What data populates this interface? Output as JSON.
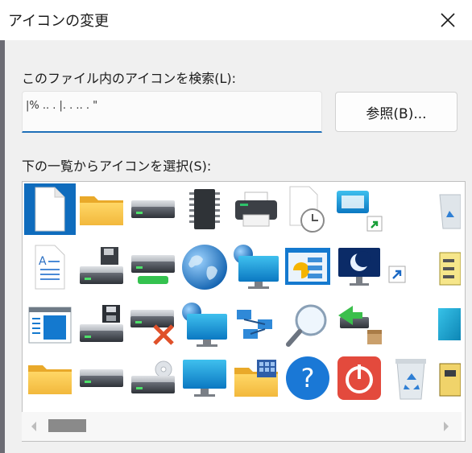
{
  "window": {
    "title": "アイコンの変更",
    "close_glyph": "✕"
  },
  "search": {
    "label": "このファイル内のアイコンを検索(L):",
    "value": "|%         ..  .  |.   .               ..  .  \"",
    "browse_label": "参照(B)..."
  },
  "icon_list": {
    "label": "下の一覧からアイコンを選択(S):",
    "selected_index": 0,
    "icons": [
      "blank-document-icon",
      "folder-icon",
      "hard-drive-icon",
      "chip-icon",
      "printer-icon",
      "clock-document-icon",
      "window-shortcut-icon",
      "recycle-bin-partial-icon",
      "text-document-icon",
      "drive-floppy-icon",
      "drive-green-icon",
      "globe-icon",
      "network-monitor-icon",
      "presentation-icon",
      "moon-monitor-icon",
      "shortcut-arrow-icon",
      "window-document-icon",
      "drive-save-icon",
      "drive-error-icon",
      "web-monitor-icon",
      "network-nodes-icon",
      "magnifier-icon",
      "usb-box-icon",
      "teal-block-icon",
      "folder-icon",
      "hard-drive-icon",
      "cd-drive-icon",
      "monitor-icon",
      "folder-grid-icon",
      "help-icon",
      "power-icon",
      "recycle-bin-icon"
    ]
  },
  "colors": {
    "accent": "#0f6cbd",
    "titlebar": "#ffffff",
    "dialog": "#f0f0f0"
  }
}
